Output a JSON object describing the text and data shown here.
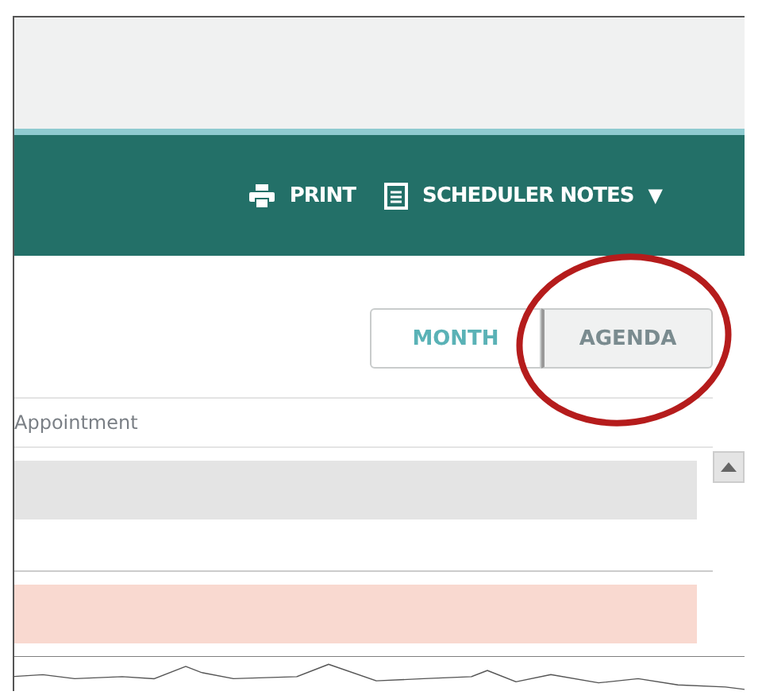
{
  "toolbar": {
    "actions": [
      {
        "kind": "print",
        "label": "PRINT"
      },
      {
        "kind": "notes",
        "label": "SCHEDULER NOTES",
        "dropdown": "▼"
      }
    ]
  },
  "view_switch": [
    {
      "label": "MONTH",
      "selected": false
    },
    {
      "label": "AGENDA",
      "selected": true
    }
  ],
  "table": {
    "columns": [
      "Appointment"
    ],
    "rows": [
      {
        "color": "#e4e4e4"
      },
      {
        "color": "#f9d9d0"
      }
    ]
  },
  "annotation": {
    "kind": "circle"
  }
}
